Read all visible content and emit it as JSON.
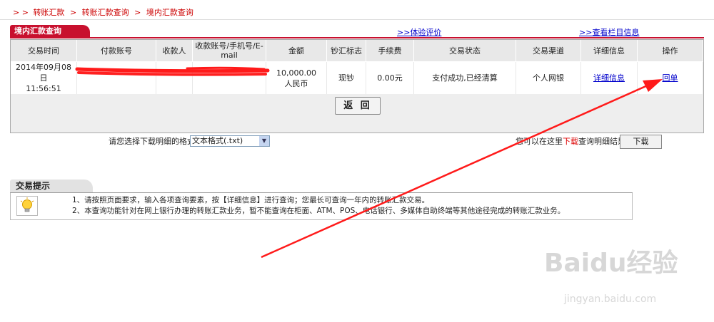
{
  "breadcrumb": {
    "prefix": "> >",
    "items": [
      "转账汇款",
      "转账汇款查询",
      "境内汇款查询"
    ],
    "sep": ">"
  },
  "tab": {
    "title": "境内汇款查询"
  },
  "links": {
    "evaluate": "体验评价",
    "column_info": "查看栏目信息",
    "prefix": ">>"
  },
  "table": {
    "headers": [
      "交易时间",
      "付款账号",
      "收款人",
      "收款账号/手机号/E-mail",
      "金额",
      "钞汇标志",
      "手续费",
      "交易状态",
      "交易渠道",
      "详细信息",
      "操作"
    ],
    "row": {
      "date": "2014年09月08日",
      "time": "11:56:51",
      "payer_account": "",
      "payee": "",
      "payee_account": "",
      "amount": "10,000.00",
      "currency": "人民币",
      "cash_flag": "现钞",
      "fee": "0.00元",
      "status": "支付成功,已经清算",
      "channel": "个人网银",
      "detail_link": "详细信息",
      "receipt_link": "回单"
    }
  },
  "back_button": "返 回",
  "download": {
    "prompt": "请您选择下载明细的格式",
    "format_selected": "文本格式(.txt)",
    "hint_pre": "您可以在这里",
    "hint_red": "下载",
    "hint_post": "查询明细结果",
    "button": "下载"
  },
  "tips": {
    "title": "交易提示",
    "line1": "1、请按照页面要求，输入各项查询要素，按【详细信息】进行查询；您最长可查询一年内的转账汇款交易。",
    "line2": "2、本查询功能针对在网上银行办理的转账汇款业务，暂不能查询在柜面、ATM、POS、电话银行、多媒体自助终端等其他途径完成的转账汇款业务。"
  },
  "watermark": {
    "brand": "Baidu经验",
    "url": "jingyan.baidu.com"
  },
  "colors": {
    "accent": "#c8102e",
    "link": "#0000cc",
    "annotation": "#ff0000"
  }
}
